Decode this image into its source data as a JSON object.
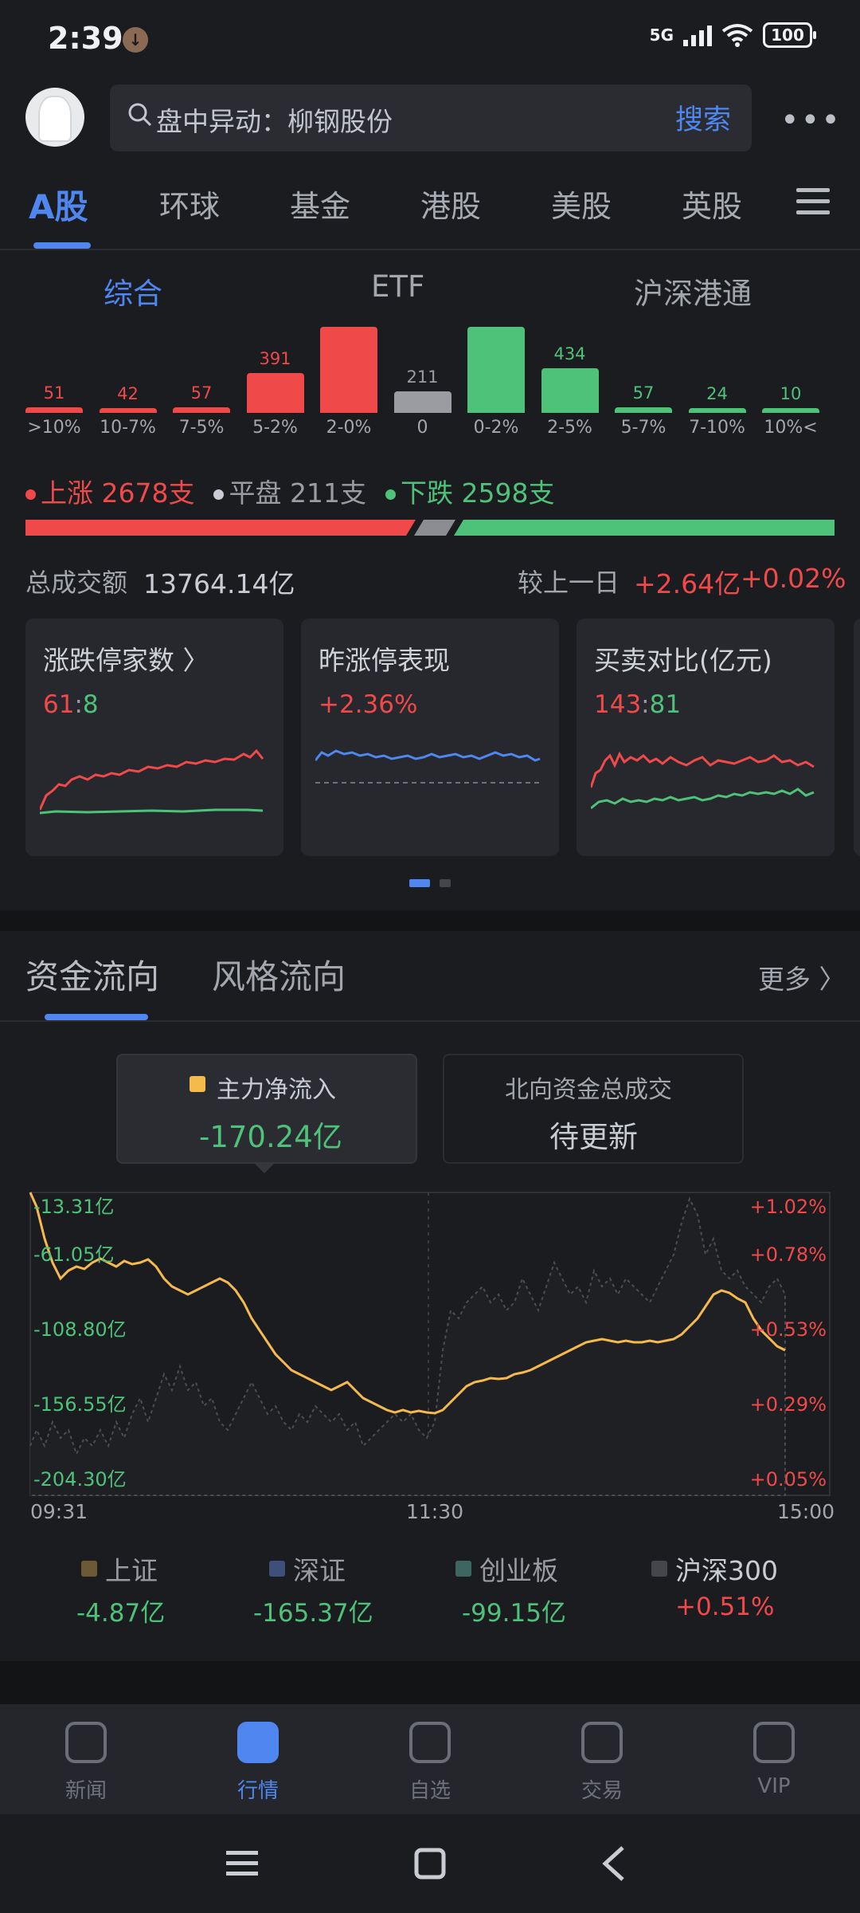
{
  "status": {
    "time": "2:39",
    "network": "5G",
    "battery": "100"
  },
  "search": {
    "text": "盘中异动：柳钢股份",
    "button": "搜索"
  },
  "market_tabs": [
    "A股",
    "环球",
    "基金",
    "港股",
    "美股",
    "英股"
  ],
  "sub_tabs": [
    "综合",
    "ETF",
    "沪深港通"
  ],
  "distribution": [
    {
      "label": ">10%",
      "value": "51",
      "color": "red"
    },
    {
      "label": "10-7%",
      "value": "42",
      "color": "red"
    },
    {
      "label": "7-5%",
      "value": "57",
      "color": "red"
    },
    {
      "label": "5-2%",
      "value": "391",
      "color": "red"
    },
    {
      "label": "2-0%",
      "value": "",
      "color": "red"
    },
    {
      "label": "0",
      "value": "211",
      "color": "grey"
    },
    {
      "label": "0-2%",
      "value": "",
      "color": "green"
    },
    {
      "label": "2-5%",
      "value": "434",
      "color": "green"
    },
    {
      "label": "5-7%",
      "value": "57",
      "color": "green"
    },
    {
      "label": "7-10%",
      "value": "24",
      "color": "green"
    },
    {
      "label": "10%<",
      "value": "10",
      "color": "green"
    }
  ],
  "counts": {
    "up": "上涨 2678支",
    "flat": "平盘 211支",
    "down": "下跌 2598支"
  },
  "turnover": {
    "label": "总成交额",
    "value": "13764.14亿",
    "compare_label": "较上一日",
    "compare_amount": "+2.64亿",
    "compare_pct": "+0.02%"
  },
  "cards": [
    {
      "title": "涨跌停家数 〉",
      "value_a": "61",
      "sep": ":",
      "value_b": "8"
    },
    {
      "title": "昨涨停表现",
      "value": "+2.36%"
    },
    {
      "title": "买卖对比(亿元)",
      "value_a": "143",
      "sep": ":",
      "value_b": "81"
    }
  ],
  "flow": {
    "tabs": [
      "资金流向",
      "风格流向"
    ],
    "more": "更多 〉",
    "main_label": "主力净流入",
    "main_value": "-170.24亿",
    "north_label": "北向资金总成交",
    "north_value": "待更新",
    "y_left": [
      "-13.31亿",
      "-61.05亿",
      "-108.80亿",
      "-156.55亿",
      "-204.30亿"
    ],
    "y_right": [
      "+1.02%",
      "+0.78%",
      "+0.53%",
      "+0.29%",
      "+0.05%"
    ],
    "x_labels": [
      "09:31",
      "11:30",
      "15:00"
    ],
    "legend": [
      {
        "name": "上证",
        "value": "-4.87亿",
        "color": "#6b5a35"
      },
      {
        "name": "深证",
        "value": "-165.37亿",
        "color": "#3e4f7a"
      },
      {
        "name": "创业板",
        "value": "-99.15亿",
        "color": "#3d6660"
      },
      {
        "name": "沪深300",
        "value": "+0.51%",
        "color": "#44464c"
      }
    ]
  },
  "nav": [
    "新闻",
    "行情",
    "自选",
    "交易",
    "VIP"
  ],
  "colors": {
    "accent": "#4f86f0",
    "up": "#f0494a",
    "down": "#4fc27a",
    "flow_line": "#f5b94c"
  }
}
